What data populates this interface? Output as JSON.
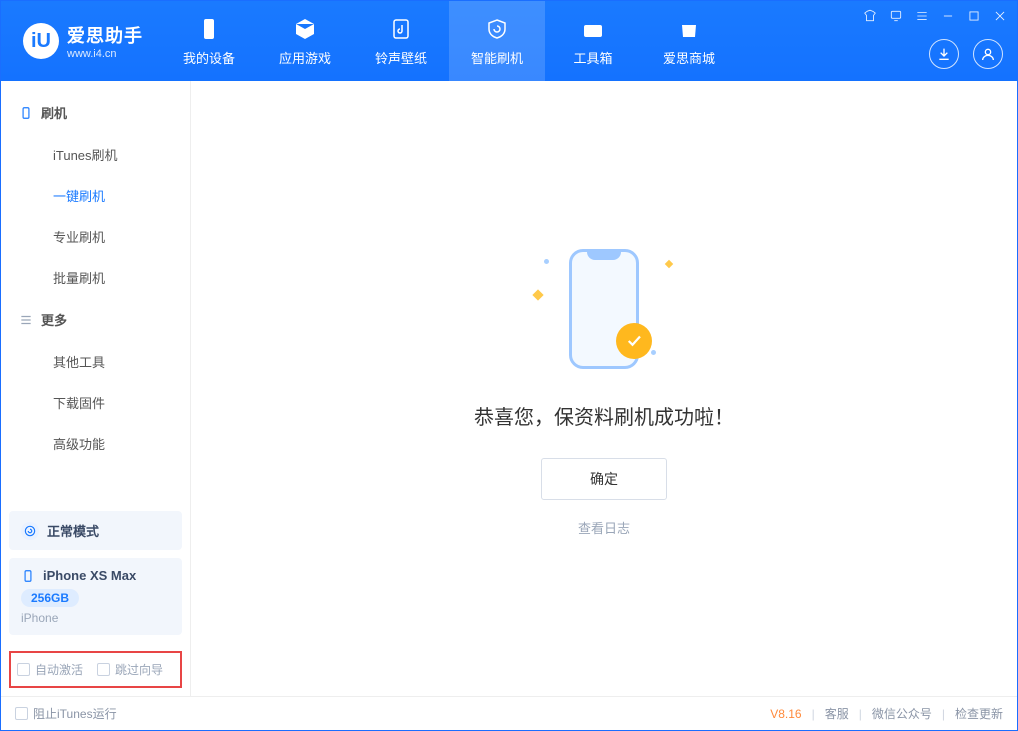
{
  "app": {
    "name_cn": "爱思助手",
    "url": "www.i4.cn"
  },
  "tabs": [
    {
      "label": "我的设备"
    },
    {
      "label": "应用游戏"
    },
    {
      "label": "铃声壁纸"
    },
    {
      "label": "智能刷机"
    },
    {
      "label": "工具箱"
    },
    {
      "label": "爱思商城"
    }
  ],
  "sidebar": {
    "group1_title": "刷机",
    "group1_items": [
      {
        "label": "iTunes刷机"
      },
      {
        "label": "一键刷机"
      },
      {
        "label": "专业刷机"
      },
      {
        "label": "批量刷机"
      }
    ],
    "group2_title": "更多",
    "group2_items": [
      {
        "label": "其他工具"
      },
      {
        "label": "下载固件"
      },
      {
        "label": "高级功能"
      }
    ]
  },
  "mode_card": {
    "label": "正常模式"
  },
  "device": {
    "name": "iPhone XS Max",
    "storage": "256GB",
    "type": "iPhone"
  },
  "options": {
    "auto_activate": "自动激活",
    "skip_guide": "跳过向导"
  },
  "main": {
    "success_text": "恭喜您，保资料刷机成功啦！",
    "ok_button": "确定",
    "view_log": "查看日志"
  },
  "statusbar": {
    "block_itunes": "阻止iTunes运行",
    "version": "V8.16",
    "links": [
      "客服",
      "微信公众号",
      "检查更新"
    ]
  },
  "colors": {
    "primary": "#1a7aff",
    "accent_warn": "#ffb81e",
    "highlight_border": "#e84545"
  }
}
